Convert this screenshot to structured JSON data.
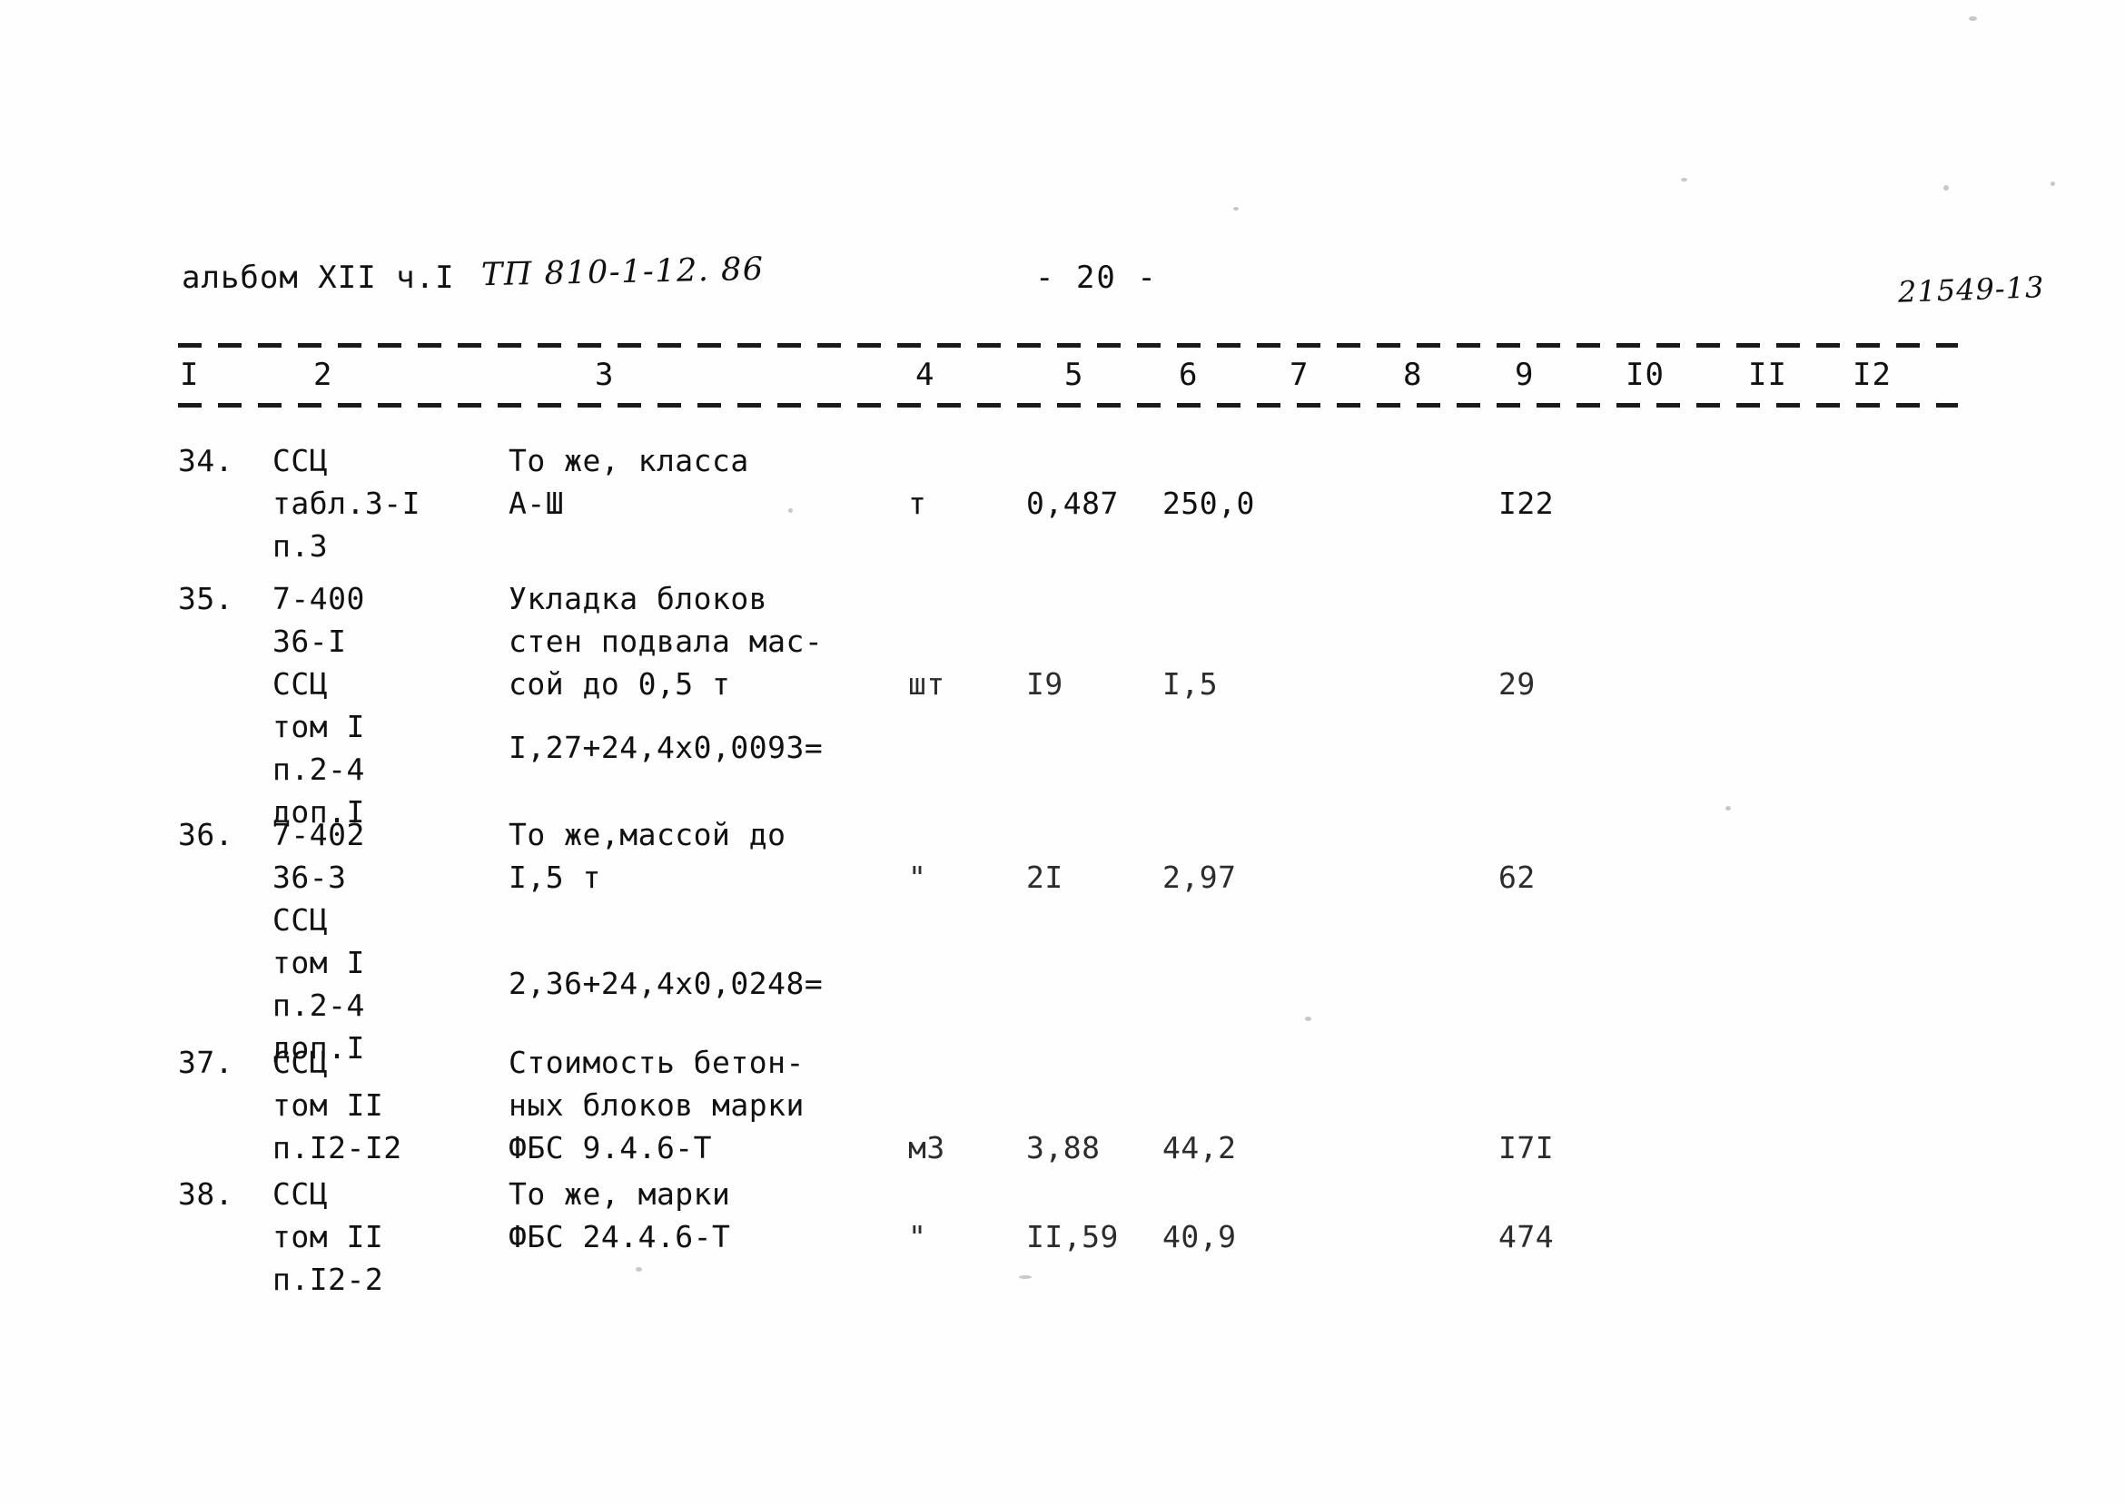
{
  "header": {
    "album": "альбом XII ч.I",
    "project_code": "ТП 810-1-12. 86",
    "page_number": "- 20 -",
    "archive_number": "21549-13"
  },
  "table": {
    "column_numbers": [
      "I",
      "2",
      "3",
      "4",
      "5",
      "6",
      "7",
      "8",
      "9",
      "I0",
      "II",
      "I2"
    ],
    "rows": [
      {
        "num": "34.",
        "justification": "ССЦ\nтабл.3-I\nп.3",
        "description": "То же, класса\nА-Ш",
        "unit": "т",
        "quantity": "0,487",
        "unit_price": "250,0",
        "total": "I22",
        "formula": ""
      },
      {
        "num": "35.",
        "justification": "7-400\n36-I\nССЦ\nтом I\nп.2-4\nдоп.I",
        "description": "Укладка блоков\nстен подвала мас-\nсой до 0,5 т",
        "unit": "шт",
        "quantity": "I9",
        "unit_price": "I,5",
        "total": "29",
        "formula": "I,27+24,4х0,0093="
      },
      {
        "num": "36.",
        "justification": "7-402\n36-3\nССЦ\nтом I\nп.2-4\nдоп.I",
        "description": "То же,массой до\nI,5 т",
        "unit": "\"",
        "quantity": "2I",
        "unit_price": "2,97",
        "total": "62",
        "formula": "2,36+24,4х0,0248="
      },
      {
        "num": "37.",
        "justification": "ССЦ\nтом II\nп.I2-I2",
        "description": "Стоимость бетон-\nных блоков марки\nФБС 9.4.6-Т",
        "unit": "м3",
        "quantity": "3,88",
        "unit_price": "44,2",
        "total": "I7I",
        "formula": ""
      },
      {
        "num": "38.",
        "justification": "ССЦ\nтом II\nп.I2-2",
        "description": "То же, марки\nФБС 24.4.6-Т",
        "unit": "\"",
        "quantity": "II,59",
        "unit_price": "40,9",
        "total": "474",
        "formula": ""
      }
    ]
  }
}
